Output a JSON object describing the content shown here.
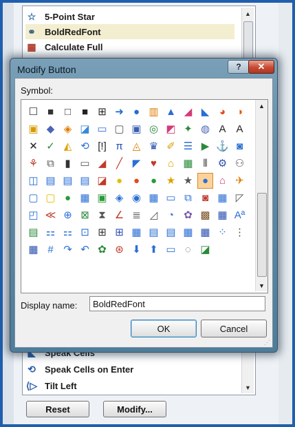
{
  "list": {
    "items_top": [
      {
        "label": "5-Point Star",
        "icon": "star-outline-icon"
      },
      {
        "label": "BoldRedFont",
        "icon": "network-icon",
        "selected": true
      },
      {
        "label": "Calculate Full",
        "icon": "calculator-icon"
      }
    ],
    "items_bottom": [
      {
        "label": "Speak Cells",
        "icon": "speak-icon"
      },
      {
        "label": "Speak Cells on Enter",
        "icon": "speak-enter-icon"
      },
      {
        "label": "Tilt Left",
        "icon": "tilt-left-icon"
      }
    ],
    "reset_label": "Reset",
    "modify_label": "Modify..."
  },
  "dialog": {
    "title": "Modify Button",
    "help_label": "?",
    "close_label": "✕",
    "symbol_label": "Symbol:",
    "display_name_label": "Display name:",
    "display_name_value": "BoldRedFont",
    "ok_label": "OK",
    "cancel_label": "Cancel",
    "selected_symbol_index": 62,
    "symbols": [
      "☐",
      "■",
      "□",
      "■",
      "⊞",
      "➜",
      "●",
      "▥",
      "▲",
      "◢",
      "◣",
      "◕",
      "◑",
      "▣",
      "◆",
      "◈",
      "◪",
      "▭",
      "▢",
      "▣",
      "◎",
      "◩",
      "✦",
      "◍",
      "A",
      "A",
      "✕",
      "✓",
      "◭",
      "⟲",
      "[!]",
      "π",
      "◬",
      "♛",
      "✐",
      "☰",
      "▶",
      "⚓",
      "◙",
      "⚘",
      "⧉",
      "▮",
      "▭",
      "◢",
      "╱",
      "◤",
      "♥",
      "⌂",
      "▦",
      "⦀",
      "⚙",
      "⚇",
      "◫",
      "▤",
      "▤",
      "▤",
      "◪",
      "●",
      "●",
      "●",
      "★",
      "★",
      "●",
      "⌂",
      "✈",
      "▢",
      "▢",
      "●",
      "▦",
      "▣",
      "◈",
      "◉",
      "▦",
      "▭",
      "⧉",
      "◙",
      "▦",
      "◸",
      "◰",
      "≪",
      "⊕",
      "⊠",
      "⧗",
      "∠",
      "≣",
      "◿",
      "◔",
      "✿",
      "▩",
      "▦",
      "Aª",
      "▤",
      "⚏",
      "⚏",
      "⊡",
      "⊞",
      "⊞",
      "▦",
      "▤",
      "▤",
      "▦",
      "▦",
      "⁘",
      "⋮",
      "▦",
      "#",
      "↷",
      "↶",
      "✿",
      "⊛",
      "⬇",
      "⬆",
      "▭",
      "◌",
      "◪"
    ],
    "symbol_colors": [
      "#333",
      "#333",
      "#333",
      "#222",
      "#222",
      "#1e6fd0",
      "#1e6fd0",
      "#e07b00",
      "#2a6ed6",
      "#d43b7a",
      "#2a6ed6",
      "#e04b1a",
      "#e85a00",
      "#d89a00",
      "#4a65b8",
      "#e07b00",
      "#3a88d8",
      "#2a6ed6",
      "#555",
      "#3a5fb0",
      "#2a8a3a",
      "#d43b7a",
      "#2a8a3a",
      "#4a65b8",
      "#222",
      "#222",
      "#222",
      "#2a8a3a",
      "#e0a000",
      "#2a6ed6",
      "#222",
      "#1e4fb0",
      "#e07b00",
      "#2a4fb0",
      "#d0a000",
      "#2a6ed6",
      "#2a8a3a",
      "#2a6ed6",
      "#2a6ed6",
      "#c0392b",
      "#555",
      "#333",
      "#555",
      "#c0392b",
      "#c0392b",
      "#2a6ed6",
      "#c0392b",
      "#e0a000",
      "#2a8a3a",
      "#333",
      "#2a4fb0",
      "#555",
      "#2a6ed6",
      "#2a6ed6",
      "#2a6ed6",
      "#2a6ed6",
      "#c0392b",
      "#e0c000",
      "#e14a1e",
      "#2a9a3a",
      "#e0a000",
      "#555",
      "#2a6ed6",
      "#d43b7a",
      "#e07b00",
      "#2a6ed6",
      "#e0c000",
      "#2a9a3a",
      "#2a6ed6",
      "#2a9a3a",
      "#2a6ed6",
      "#2a6ed6",
      "#2a6ed6",
      "#2a6ed6",
      "#2a6ed6",
      "#c0392b",
      "#2a6ed6",
      "#555",
      "#2a6ed6",
      "#c0392b",
      "#2a6ed6",
      "#2a8a3a",
      "#555",
      "#c0392b",
      "#555",
      "#555",
      "#2a6ed6",
      "#7a5aa8",
      "#7a5020",
      "#2a4fb0",
      "#2a6ed6",
      "#2a8a3a",
      "#2a6ed6",
      "#2a6ed6",
      "#2a6ed6",
      "#333",
      "#2a4fb0",
      "#2a6ed6",
      "#2a6ed6",
      "#2a6ed6",
      "#2a6ed6",
      "#2a4fb0",
      "#2a6ed6",
      "#555",
      "#2a4fb0",
      "#2a6ed6",
      "#2a6ed6",
      "#2a6ed6",
      "#2a8a3a",
      "#c0392b",
      "#2a6ed6",
      "#2a6ed6",
      "#2a6ed6",
      "#555",
      "#2a8a3a"
    ]
  }
}
